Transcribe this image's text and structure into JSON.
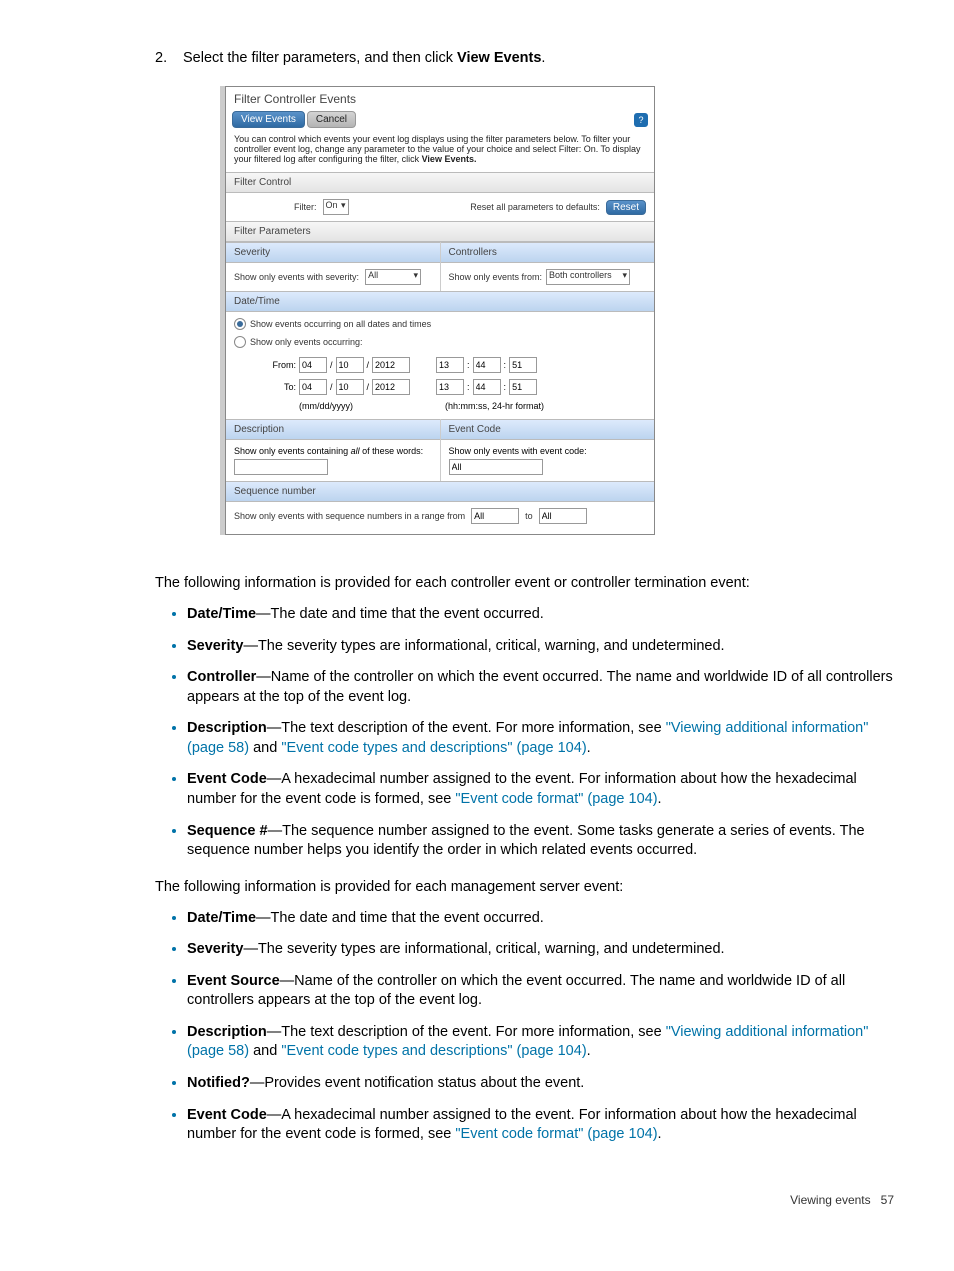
{
  "step": {
    "number": "2.",
    "text_before": "Select the filter parameters, and then click ",
    "bold": "View Events",
    "text_after": "."
  },
  "dialog": {
    "title": "Filter Controller Events",
    "view_btn": "View Events",
    "cancel_btn": "Cancel",
    "help": "?",
    "intro_pre": "You can control which events your event log displays using the filter parameters below. To filter your controller event log, change any parameter to the value of your choice and select Filter: On. To display your filtered log after configuring the filter, click ",
    "intro_bold": "View Events.",
    "filter_control_header": "Filter Control",
    "filter_label": "Filter:",
    "filter_value": "On",
    "reset_label": "Reset all parameters to defaults:",
    "reset_btn": "Reset",
    "filter_params_header": "Filter Parameters",
    "severity_header": "Severity",
    "controllers_header": "Controllers",
    "severity_label": "Show only events with severity:",
    "severity_value": "All",
    "controllers_label": "Show only events from:",
    "controllers_value": "Both controllers",
    "datetime_header": "Date/Time",
    "dt_radio1": "Show events occurring on all dates and times",
    "dt_radio2": "Show only events occurring:",
    "from_label": "From:",
    "to_label": "To:",
    "from": {
      "mm": "04",
      "dd": "10",
      "yyyy": "2012",
      "hh": "13",
      "mi": "44",
      "ss": "51"
    },
    "to": {
      "mm": "04",
      "dd": "10",
      "yyyy": "2012",
      "hh": "13",
      "mi": "44",
      "ss": "51"
    },
    "fmt_date": "(mm/dd/yyyy)",
    "fmt_time": "(hh:mm:ss, 24-hr format)",
    "desc_header": "Description",
    "eventcode_header": "Event Code",
    "desc_label_pre": "Show only events containing ",
    "desc_label_italic": "all",
    "desc_label_post": " of these words:",
    "eventcode_label": "Show only events with event code:",
    "eventcode_value": "All",
    "seq_header": "Sequence number",
    "seq_label": "Show only events with sequence numbers in a range from",
    "seq_from": "All",
    "seq_to_label": "to",
    "seq_to": "All"
  },
  "para1": "The following information is provided for each controller event or controller termination event:",
  "controller_bullets": {
    "b1_bold": "Date/Time",
    "b1_text": "—The date and time that the event occurred.",
    "b2_bold": "Severity",
    "b2_text": "—The severity types are informational, critical, warning, and undetermined.",
    "b3_bold": "Controller",
    "b3_text": "—Name of the controller on which the event occurred. The name and worldwide ID of all controllers appears at the top of the event log.",
    "b4_bold": "Description",
    "b4_pre": "—The text description of the event. For more information, see ",
    "b4_link1": "\"Viewing additional information\" (page 58)",
    "b4_mid": " and ",
    "b4_link2": "\"Event code types and descriptions\" (page 104)",
    "b4_post": ".",
    "b5_bold": "Event Code",
    "b5_pre": "—A hexadecimal number assigned to the event. For information about how the hexadecimal number for the event code is formed, see ",
    "b5_link": "\"Event code format\" (page 104)",
    "b5_post": ".",
    "b6_bold": "Sequence #",
    "b6_text": "—The sequence number assigned to the event. Some tasks generate a series of events. The sequence number helps you identify the order in which related events occurred."
  },
  "para2": "The following information is provided for each management server event:",
  "server_bullets": {
    "b1_bold": "Date/Time",
    "b1_text": "—The date and time that the event occurred.",
    "b2_bold": "Severity",
    "b2_text": "—The severity types are informational, critical, warning, and undetermined.",
    "b3_bold": "Event Source",
    "b3_text": "—Name of the controller on which the event occurred. The name and worldwide ID of all controllers appears at the top of the event log.",
    "b4_bold": "Description",
    "b4_pre": "—The text description of the event. For more information, see ",
    "b4_link1": "\"Viewing additional information\" (page 58)",
    "b4_mid": " and ",
    "b4_link2": "\"Event code types and descriptions\" (page 104)",
    "b4_post": ".",
    "b5_bold": "Notified?",
    "b5_text": "—Provides event notification status about the event.",
    "b6_bold": "Event Code",
    "b6_pre": "—A hexadecimal number assigned to the event. For information about how the hexadecimal number for the event code is formed, see ",
    "b6_link": "\"Event code format\" (page 104)",
    "b6_post": "."
  },
  "footer": {
    "label": "Viewing events",
    "page": "57"
  }
}
